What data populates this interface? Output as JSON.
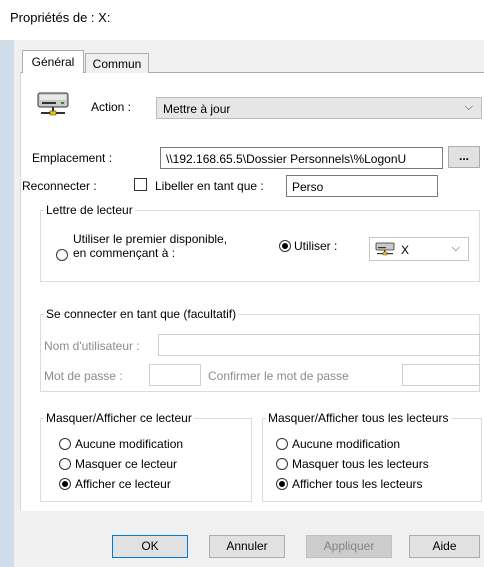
{
  "window": {
    "title": "Propriétés de : X:"
  },
  "tabs": [
    {
      "label": "Général",
      "active": true
    },
    {
      "label": "Commun",
      "active": false
    }
  ],
  "action": {
    "label": "Action :",
    "value": "Mettre à jour",
    "icon": "network-drive-icon"
  },
  "location": {
    "label": "Emplacement :",
    "value": "\\\\192.168.65.5\\Dossier Personnels\\%LogonU",
    "browse_label": "..."
  },
  "reconnect": {
    "label": "Reconnecter :",
    "checked": false,
    "label_as": "Libeller en tant que :",
    "label_value": "Perso"
  },
  "drive_letter": {
    "legend": "Lettre de lecteur",
    "first_available_line1": "Utiliser le premier disponible,",
    "first_available_line2": "en commençant à :",
    "use_label": "Utiliser :",
    "use_selected": true,
    "drive_value": "X"
  },
  "connect_as": {
    "legend": "Se connecter en tant que (facultatif)",
    "username_label": "Nom d'utilisateur :",
    "password_label": "Mot de passe :",
    "confirm_label": "Confirmer le mot de passe"
  },
  "hide_show_this": {
    "legend": "Masquer/Afficher ce lecteur",
    "options": [
      {
        "label": "Aucune modification",
        "selected": false
      },
      {
        "label": "Masquer ce lecteur",
        "selected": false
      },
      {
        "label": "Afficher ce lecteur",
        "selected": true
      }
    ]
  },
  "hide_show_all": {
    "legend": "Masquer/Afficher tous les lecteurs",
    "options": [
      {
        "label": "Aucune modification",
        "selected": false
      },
      {
        "label": "Masquer tous les lecteurs",
        "selected": false
      },
      {
        "label": "Afficher tous les lecteurs",
        "selected": true
      }
    ]
  },
  "buttons": {
    "ok": "OK",
    "cancel": "Annuler",
    "apply": "Appliquer",
    "help": "Aide"
  },
  "colors": {
    "accent": "#0078d7",
    "dialog_bg": "#f0f0f0",
    "window_edge": "#cfdcea"
  }
}
